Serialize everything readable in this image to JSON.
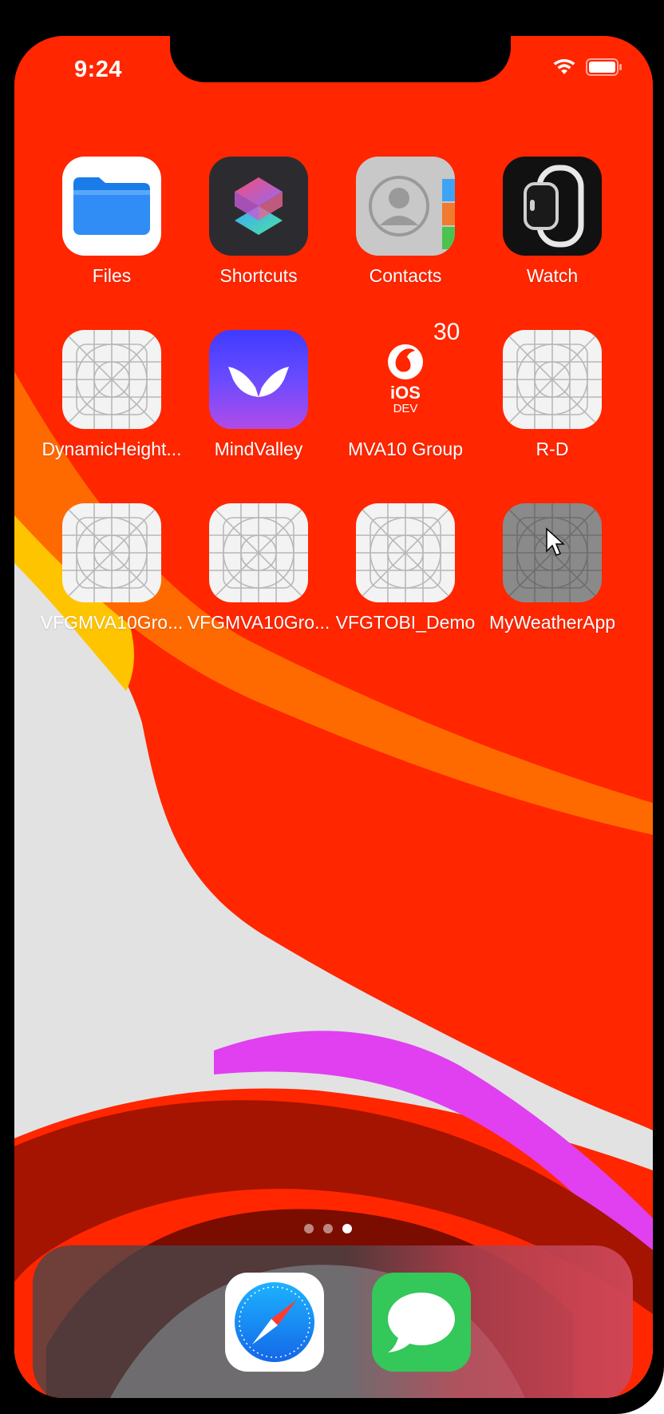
{
  "status_bar": {
    "time": "9:24",
    "icons": [
      "wifi-icon",
      "battery-icon"
    ]
  },
  "home_screen": {
    "apps": [
      {
        "label": "Files",
        "icon": "files-folder-icon"
      },
      {
        "label": "Shortcuts",
        "icon": "shortcuts-icon"
      },
      {
        "label": "Contacts",
        "icon": "contacts-icon"
      },
      {
        "label": "Watch",
        "icon": "watch-icon"
      },
      {
        "label": "DynamicHeight...",
        "icon": "placeholder-app-icon"
      },
      {
        "label": "MindValley",
        "icon": "mindvalley-icon"
      },
      {
        "label": "MVA10 Group",
        "icon": "vodafone-ios-dev-icon",
        "icon_text": "iOS",
        "icon_subtext": "DEV",
        "badge": "30"
      },
      {
        "label": "R-D",
        "icon": "placeholder-app-icon"
      },
      {
        "label": "VFGMVA10Gro...",
        "icon": "placeholder-app-icon"
      },
      {
        "label": "VFGMVA10Gro...",
        "icon": "placeholder-app-icon"
      },
      {
        "label": "VFGTOBI_Demo",
        "icon": "placeholder-app-icon"
      },
      {
        "label": "MyWeatherApp",
        "icon": "placeholder-app-icon-pressed"
      }
    ]
  },
  "page_indicator": {
    "page_count": 3,
    "current_page": 3
  },
  "dock": {
    "apps": [
      {
        "name": "Safari",
        "icon": "safari-compass-icon"
      },
      {
        "name": "Messages",
        "icon": "messages-bubble-icon"
      }
    ]
  },
  "colors": {
    "wallpaper_red": "#FF2600",
    "wallpaper_grey": "#E2E2E2",
    "wallpaper_yellow": "#FFC400",
    "wallpaper_orange": "#FF6A00",
    "wallpaper_magenta": "#E040F0",
    "wallpaper_dark_red": "#9E1200",
    "accent_files": "#2F8DF5",
    "accent_messages": "#34C759"
  }
}
